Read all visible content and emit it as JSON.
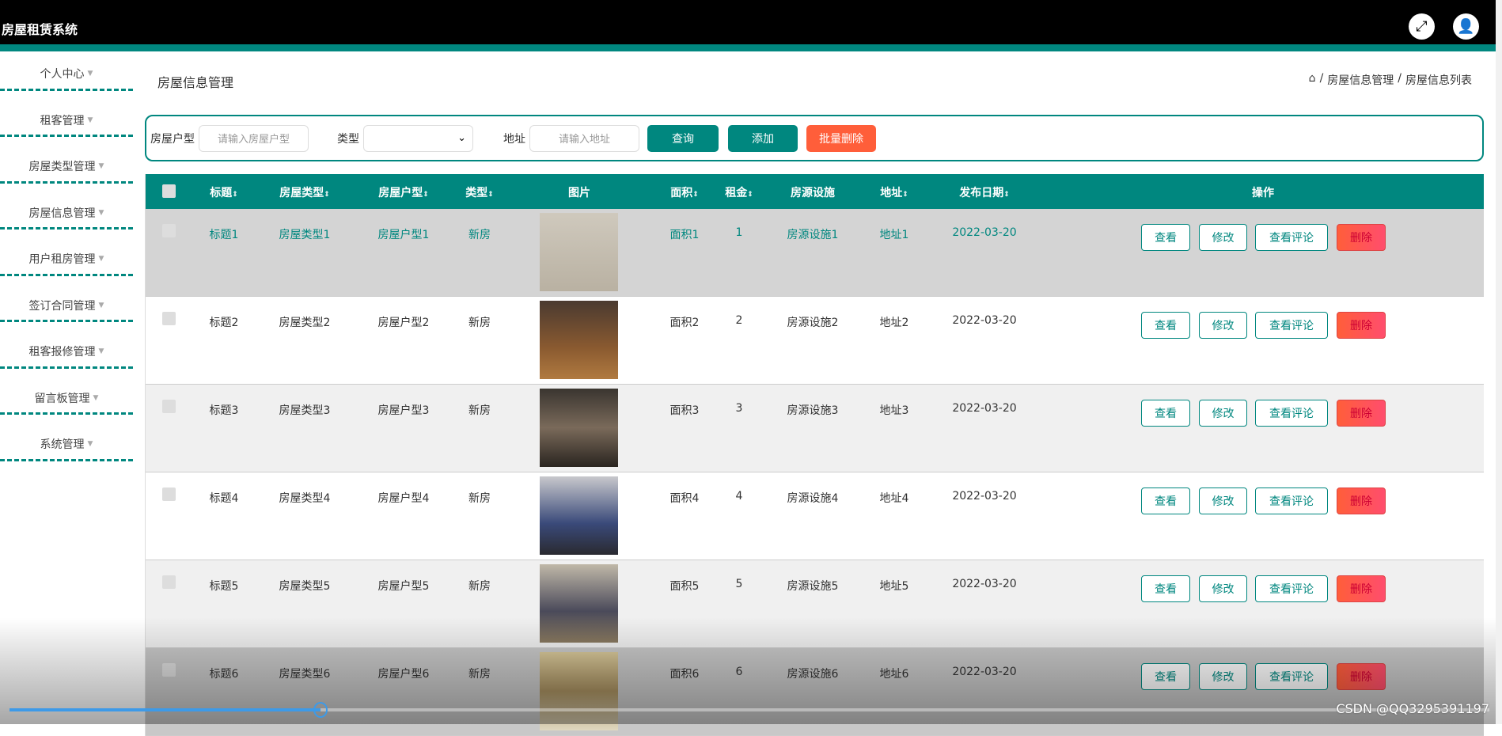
{
  "app": {
    "title": "房屋租赁系统",
    "fullscreen_icon": "expand-icon",
    "user_icon": "user-icon"
  },
  "sidebar": {
    "items": [
      {
        "label": "个人中心"
      },
      {
        "label": "租客管理"
      },
      {
        "label": "房屋类型管理"
      },
      {
        "label": "房屋信息管理"
      },
      {
        "label": "用户租房管理"
      },
      {
        "label": "签订合同管理"
      },
      {
        "label": "租客报修管理"
      },
      {
        "label": "留言板管理"
      },
      {
        "label": "系统管理"
      }
    ]
  },
  "page": {
    "title": "房屋信息管理",
    "breadcrumb": [
      "房屋信息管理",
      "房屋信息列表"
    ]
  },
  "search": {
    "huxing_label": "房屋户型",
    "huxing_placeholder": "请输入房屋户型",
    "type_label": "类型",
    "type_value": "",
    "address_label": "地址",
    "address_placeholder": "请输入地址",
    "query": "查询",
    "add": "添加",
    "batch_delete": "批量删除"
  },
  "table": {
    "headers": [
      "标题",
      "房屋类型",
      "房屋户型",
      "类型",
      "图片",
      "面积",
      "租金",
      "房源设施",
      "地址",
      "发布日期",
      "操作"
    ],
    "actions": [
      "查看",
      "修改",
      "查看评论",
      "删除"
    ],
    "rows": [
      [
        "标题1",
        "房屋类型1",
        "房屋户型1",
        "新房",
        "面积1",
        "1",
        "房源设施1",
        "地址1",
        "2022-03-20"
      ],
      [
        "标题2",
        "房屋类型2",
        "房屋户型2",
        "新房",
        "面积2",
        "2",
        "房源设施2",
        "地址2",
        "2022-03-20"
      ],
      [
        "标题3",
        "房屋类型3",
        "房屋户型3",
        "新房",
        "面积3",
        "3",
        "房源设施3",
        "地址3",
        "2022-03-20"
      ],
      [
        "标题4",
        "房屋类型4",
        "房屋户型4",
        "新房",
        "面积4",
        "4",
        "房源设施4",
        "地址4",
        "2022-03-20"
      ],
      [
        "标题5",
        "房屋类型5",
        "房屋户型5",
        "新房",
        "面积5",
        "5",
        "房源设施5",
        "地址5",
        "2022-03-20"
      ],
      [
        "标题6",
        "房屋类型6",
        "房屋户型6",
        "新房",
        "面积6",
        "6",
        "房源设施6",
        "地址6",
        "2022-03-20"
      ]
    ]
  },
  "colors": {
    "primary": "#00877f",
    "danger": "#ff5e3a",
    "hover_row": "#d4d4d4"
  },
  "player": {
    "progress_percent": 21
  },
  "watermark": "CSDN @QQ3295391197"
}
